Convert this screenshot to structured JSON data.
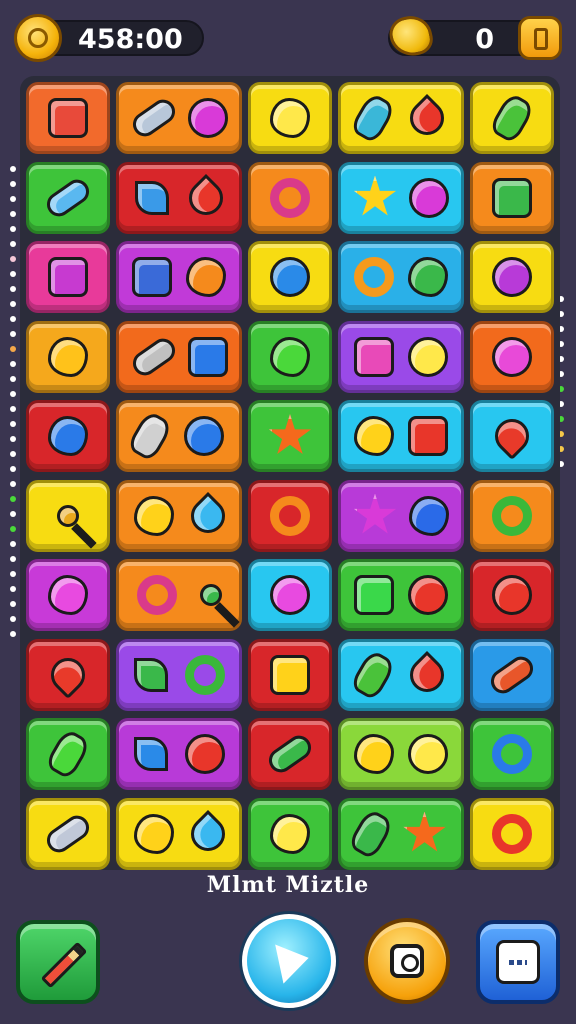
{
  "hud": {
    "score_text": "458:00",
    "gold_count": "0",
    "icons": {
      "left": "coin-icon",
      "right": "gold-nugget-icon",
      "shop": "coin-box-icon"
    }
  },
  "board": {
    "columns": 5,
    "rows": [
      [
        {
          "color": "#f26a2c",
          "items": [
            {
              "shape": "square",
              "color": "#e84a3a"
            }
          ]
        },
        {
          "color": "#f58a1c",
          "items": [
            {
              "shape": "capsule",
              "color": "#b8c7d9"
            },
            {
              "shape": "circle",
              "color": "#d93ad8"
            }
          ]
        },
        {
          "color": "#f7dc12",
          "items": [
            {
              "shape": "blob",
              "color": "#ffe84a"
            }
          ]
        },
        {
          "color": "#f7dc12",
          "items": [
            {
              "shape": "bottle",
              "color": "#3ab7d8"
            },
            {
              "shape": "drop",
              "color": "#e8362a"
            }
          ]
        },
        {
          "color": "#f7dc12",
          "items": [
            {
              "shape": "bottle",
              "color": "#4ac23a"
            }
          ]
        }
      ],
      [
        {
          "color": "#3ec43a",
          "items": [
            {
              "shape": "capsule",
              "color": "#5ab8f0"
            }
          ]
        },
        {
          "color": "#d8262a",
          "items": [
            {
              "shape": "leaf",
              "color": "#3a9ae8"
            },
            {
              "shape": "drop",
              "color": "#e8362a"
            }
          ]
        },
        {
          "color": "#f58a1c",
          "items": [
            {
              "shape": "ring",
              "color": "#d93a8a"
            }
          ]
        },
        {
          "color": "#28c7f0",
          "items": [
            {
              "shape": "star",
              "color": "#ffd21a"
            },
            {
              "shape": "circle",
              "color": "#d93ad8"
            }
          ]
        },
        {
          "color": "#f58a1c",
          "items": [
            {
              "shape": "square",
              "color": "#3ab84a"
            }
          ]
        }
      ],
      [
        {
          "color": "#e83a9a",
          "items": [
            {
              "shape": "square",
              "color": "#c73ad0"
            }
          ]
        },
        {
          "color": "#c13ad8",
          "items": [
            {
              "shape": "square",
              "color": "#3a6ad8"
            },
            {
              "shape": "blob",
              "color": "#f58a1c"
            }
          ]
        },
        {
          "color": "#f7dc12",
          "items": [
            {
              "shape": "circle",
              "color": "#2a8ae8"
            }
          ]
        },
        {
          "color": "#2ab0e8",
          "items": [
            {
              "shape": "ring",
              "color": "#f59a1c"
            },
            {
              "shape": "blob",
              "color": "#3ab84a"
            }
          ]
        },
        {
          "color": "#f7dc12",
          "items": [
            {
              "shape": "circle",
              "color": "#b83ad8"
            }
          ]
        }
      ],
      [
        {
          "color": "#f5a81c",
          "items": [
            {
              "shape": "blob",
              "color": "#ffc21a"
            }
          ]
        },
        {
          "color": "#f26a1c",
          "items": [
            {
              "shape": "capsule",
              "color": "#c0c0c0"
            },
            {
              "shape": "square",
              "color": "#2a7ae8"
            }
          ]
        },
        {
          "color": "#3ec43a",
          "items": [
            {
              "shape": "blob",
              "color": "#4ad83a"
            }
          ]
        },
        {
          "color": "#9a4ae8",
          "items": [
            {
              "shape": "square",
              "color": "#e84ab8"
            },
            {
              "shape": "circle",
              "color": "#ffe84a"
            }
          ]
        },
        {
          "color": "#f26a1c",
          "items": [
            {
              "shape": "circle",
              "color": "#e84ad8"
            }
          ]
        }
      ],
      [
        {
          "color": "#d8262a",
          "items": [
            {
              "shape": "blob",
              "color": "#2a7ae8"
            }
          ]
        },
        {
          "color": "#f58a1c",
          "items": [
            {
              "shape": "bottle",
              "color": "#d0d0d0"
            },
            {
              "shape": "circle",
              "color": "#2a7ae8"
            }
          ]
        },
        {
          "color": "#3ec43a",
          "items": [
            {
              "shape": "star",
              "color": "#f5691c"
            }
          ]
        },
        {
          "color": "#28c7f0",
          "items": [
            {
              "shape": "blob",
              "color": "#ffd21a"
            },
            {
              "shape": "square",
              "color": "#e8362a"
            }
          ]
        },
        {
          "color": "#28c7f0",
          "items": [
            {
              "shape": "heart",
              "color": "#e83a2a"
            }
          ]
        }
      ],
      [
        {
          "color": "#f7dc12",
          "items": [
            {
              "shape": "key",
              "color": "#e8a81c"
            }
          ]
        },
        {
          "color": "#f58a1c",
          "items": [
            {
              "shape": "blob",
              "color": "#ffd21a"
            },
            {
              "shape": "drop",
              "color": "#3ab8f0"
            }
          ]
        },
        {
          "color": "#d8262a",
          "items": [
            {
              "shape": "ring",
              "color": "#f58a1c"
            }
          ]
        },
        {
          "color": "#b83ad8",
          "items": [
            {
              "shape": "star",
              "color": "#d93ad8"
            },
            {
              "shape": "blob",
              "color": "#2a6ae8"
            }
          ]
        },
        {
          "color": "#f58a1c",
          "items": [
            {
              "shape": "ring",
              "color": "#3ab83a"
            }
          ]
        }
      ],
      [
        {
          "color": "#c83ad8",
          "items": [
            {
              "shape": "blob",
              "color": "#e84ae0"
            }
          ]
        },
        {
          "color": "#f58a1c",
          "items": [
            {
              "shape": "ring",
              "color": "#d93a8a"
            },
            {
              "shape": "key",
              "color": "#3ab84a"
            }
          ]
        },
        {
          "color": "#28c7f0",
          "items": [
            {
              "shape": "circle",
              "color": "#e84ae0"
            }
          ]
        },
        {
          "color": "#3ec43a",
          "items": [
            {
              "shape": "square",
              "color": "#3ad84a"
            },
            {
              "shape": "circle",
              "color": "#e8362a"
            }
          ]
        },
        {
          "color": "#d8262a",
          "items": [
            {
              "shape": "circle",
              "color": "#e8362a"
            }
          ]
        }
      ],
      [
        {
          "color": "#d8262a",
          "items": [
            {
              "shape": "heart",
              "color": "#e83a2a"
            }
          ]
        },
        {
          "color": "#9a4ae8",
          "items": [
            {
              "shape": "leaf",
              "color": "#3ab84a"
            },
            {
              "shape": "ring",
              "color": "#3ab83a"
            }
          ]
        },
        {
          "color": "#d8262a",
          "items": [
            {
              "shape": "square",
              "color": "#ffd21a"
            }
          ]
        },
        {
          "color": "#28c7f0",
          "items": [
            {
              "shape": "bottle",
              "color": "#4ac23a"
            },
            {
              "shape": "drop",
              "color": "#e8362a"
            }
          ]
        },
        {
          "color": "#2a9ae8",
          "items": [
            {
              "shape": "capsule",
              "color": "#e8562a"
            }
          ]
        }
      ],
      [
        {
          "color": "#3ec43a",
          "items": [
            {
              "shape": "bottle",
              "color": "#4ad83a"
            }
          ]
        },
        {
          "color": "#b83ad8",
          "items": [
            {
              "shape": "leaf",
              "color": "#2a8ae8"
            },
            {
              "shape": "circle",
              "color": "#e8362a"
            }
          ]
        },
        {
          "color": "#d8262a",
          "items": [
            {
              "shape": "capsule",
              "color": "#3ab84a"
            }
          ]
        },
        {
          "color": "#8ad83a",
          "items": [
            {
              "shape": "blob",
              "color": "#ffd21a"
            },
            {
              "shape": "circle",
              "color": "#ffe84a"
            }
          ]
        },
        {
          "color": "#3ec43a",
          "items": [
            {
              "shape": "ring",
              "color": "#2a7ae8"
            }
          ]
        }
      ],
      [
        {
          "color": "#f7dc12",
          "items": [
            {
              "shape": "capsule",
              "color": "#c0c8d8"
            }
          ]
        },
        {
          "color": "#f7dc12",
          "items": [
            {
              "shape": "blob",
              "color": "#ffd21a"
            },
            {
              "shape": "drop",
              "color": "#3ab8f0"
            }
          ]
        },
        {
          "color": "#3ec43a",
          "items": [
            {
              "shape": "blob",
              "color": "#ffe84a"
            }
          ]
        },
        {
          "color": "#3ec43a",
          "items": [
            {
              "shape": "bottle",
              "color": "#3ab84a"
            },
            {
              "shape": "star",
              "color": "#f5691c"
            }
          ]
        },
        {
          "color": "#f7dc12",
          "items": [
            {
              "shape": "ring",
              "color": "#e8362a"
            }
          ]
        }
      ]
    ],
    "tile_spans": [
      1,
      1.5,
      1,
      1.5,
      1
    ]
  },
  "title": "Mlmt Miztle",
  "buttons": {
    "pencil": "pencil-icon",
    "play": "play-icon",
    "hint": "magnifier-icon",
    "menu": "menu-card-icon"
  }
}
